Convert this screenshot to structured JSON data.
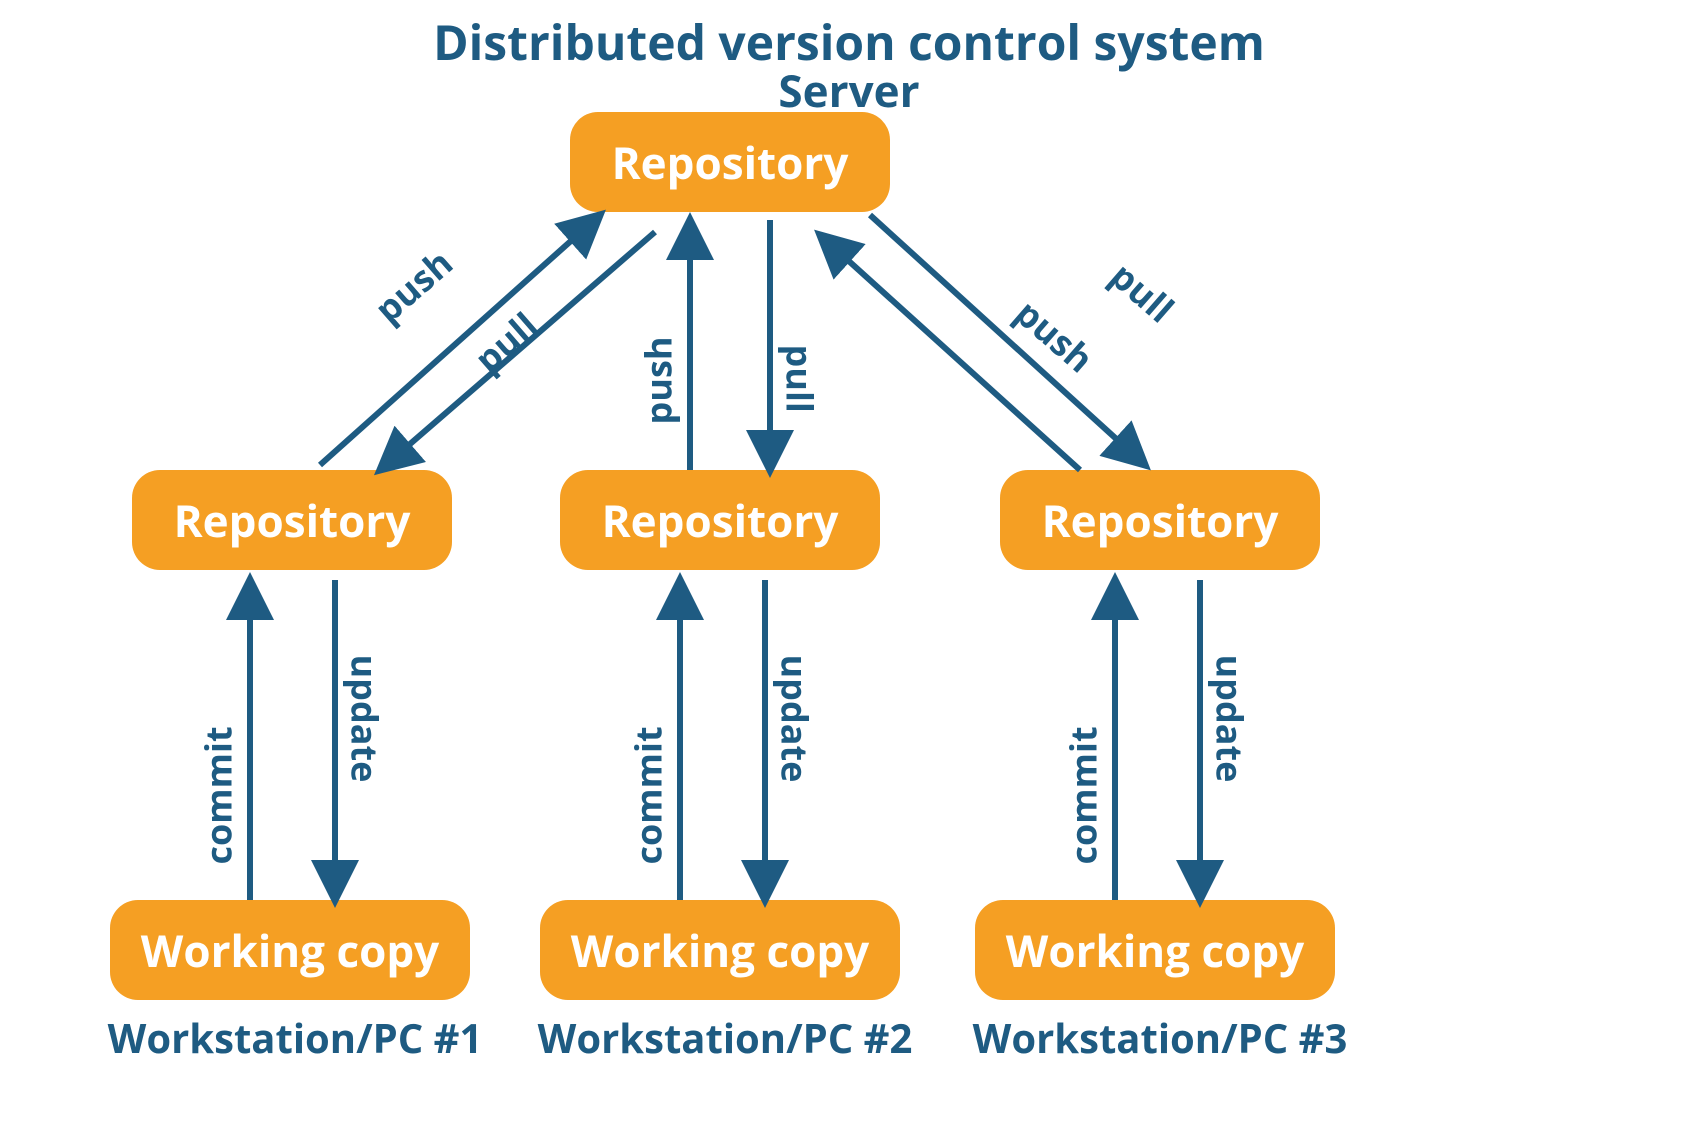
{
  "colors": {
    "text": "#1e5b82",
    "node": "#f59f23",
    "nodeText": "#ffffff",
    "arrow": "#1e5b82"
  },
  "title": "Distributed version control system",
  "serverLabel": "Server",
  "nodes": {
    "serverRepo": "Repository",
    "repo1": "Repository",
    "repo2": "Repository",
    "repo3": "Repository",
    "wc1": "Working copy",
    "wc2": "Working copy",
    "wc3": "Working copy"
  },
  "captions": {
    "ws1": "Workstation/PC #1",
    "ws2": "Workstation/PC #2",
    "ws3": "Workstation/PC #3"
  },
  "edges": {
    "push": "push",
    "pull": "pull",
    "commit": "commit",
    "update": "update"
  }
}
